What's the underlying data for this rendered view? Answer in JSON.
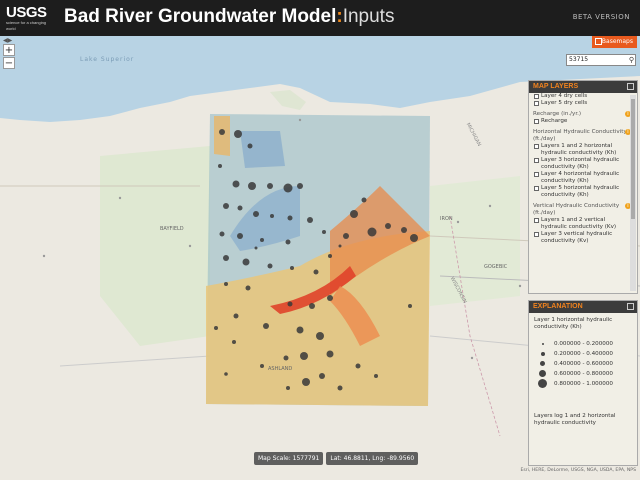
{
  "header": {
    "logo_text": "USGS",
    "logo_tagline": "science for a changing world",
    "title_main": "Bad River Groundwater Model",
    "title_sep": ":",
    "title_sub": "Inputs",
    "version": "BETA VERSION"
  },
  "toolbar": {
    "basemap_label": "Basemaps",
    "search_value": "53715"
  },
  "map_labels": {
    "bayfield": "BAYFIELD",
    "ashland": "ASHLAND",
    "iron": "IRON",
    "gogebic": "GOGEBIC",
    "michigan": "MICHIGAN",
    "wisconsin": "WISCONSIN",
    "lake_superior": "Lake Superior"
  },
  "map_layers": {
    "title": "MAP LAYERS",
    "groups": [
      {
        "label": "",
        "items": [
          "Layer 4 dry cells",
          "Layer 5 dry cells"
        ]
      },
      {
        "label": "Recharge (in./yr.)",
        "items": [
          "Recharge"
        ]
      },
      {
        "label": "Horizontal Hydraulic Conductivity (ft./day)",
        "items": [
          "Layers 1 and 2 horizontal hydraulic conductivity (Kh)",
          "Layer 3 horizontal hydraulic conductivity (Kh)",
          "Layer 4 horizontal hydraulic conductivity (Kh)",
          "Layer 5 horizontal hydraulic conductivity (Kh)"
        ]
      },
      {
        "label": "Vertical Hydraulic Conductivity (ft./day)",
        "items": [
          "Layers 1 and 2 vertical hydraulic conductivity (Kv)",
          "Layer 3 vertical hydraulic conductivity (Kv)"
        ]
      }
    ]
  },
  "explanation": {
    "title": "EXPLANATION",
    "layer_title": "Layer 1 horizontal hydraulic conductivity (Kh)",
    "rows": [
      "0.000000 - 0.200000",
      "0.200000 - 0.400000",
      "0.400000 - 0.600000",
      "0.600000 - 0.800000",
      "0.800000 - 1.000000"
    ],
    "footer": "Layers log 1 and 2 horizontal hydraulic conductivity"
  },
  "status": {
    "map_scale": "Map Scale: 1577791",
    "latlng": "Lat: 46.8811, Lng: -89.9560"
  },
  "attribution": "Esri, HERE, DeLorme, USGS, NGA, USDA, EPA, NPS",
  "colors": {
    "header_bg": "#1d1d1d",
    "accent": "#f0821e",
    "basemap_button": "#e85a1e"
  }
}
